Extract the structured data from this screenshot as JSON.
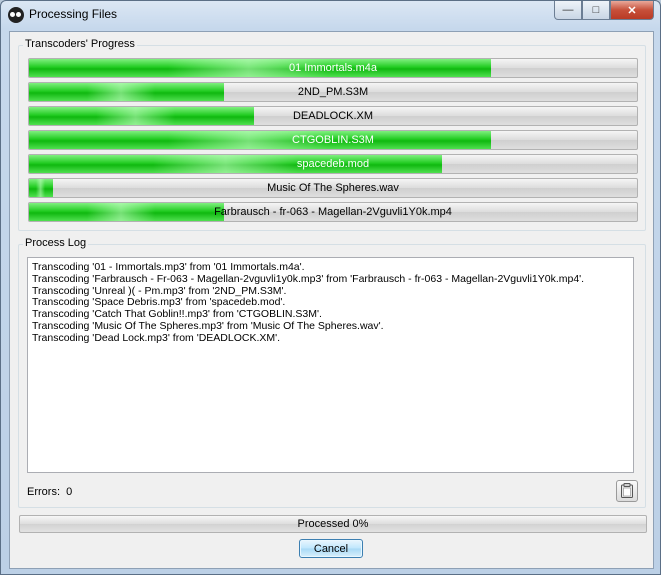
{
  "window": {
    "title": "Processing Files",
    "minimize_glyph": "—",
    "maximize_glyph": "□",
    "close_glyph": "✕"
  },
  "transcoders": {
    "label": "Transcoders' Progress",
    "bars": [
      {
        "file": "01 Immortals.m4a",
        "progress": 0.76,
        "text_color": "#ffffff"
      },
      {
        "file": "2ND_PM.S3M",
        "progress": 0.32,
        "text_color": "#000000"
      },
      {
        "file": "DEADLOCK.XM",
        "progress": 0.37,
        "text_color": "#000000"
      },
      {
        "file": "CTGOBLIN.S3M",
        "progress": 0.76,
        "text_color": "#ffffff"
      },
      {
        "file": "spacedeb.mod",
        "progress": 0.68,
        "text_color": "#ffffff"
      },
      {
        "file": "Music Of The Spheres.wav",
        "progress": 0.04,
        "text_color": "#000000"
      },
      {
        "file": "Farbrausch - fr-063 - Magellan-2Vguvli1Y0k.mp4",
        "progress": 0.32,
        "text_color": "#000000"
      }
    ]
  },
  "log": {
    "label": "Process Log",
    "lines": [
      "Transcoding '01 - Immortals.mp3' from '01 Immortals.m4a'.",
      "Transcoding 'Farbrausch - Fr-063 - Magellan-2vguvli1y0k.mp3' from 'Farbrausch - fr-063 - Magellan-2Vguvli1Y0k.mp4'.",
      "Transcoding 'Unreal )( - Pm.mp3' from '2ND_PM.S3M'.",
      "Transcoding 'Space Debris.mp3' from 'spacedeb.mod'.",
      "Transcoding 'Catch That Goblin!!.mp3' from 'CTGOBLIN.S3M'.",
      "Transcoding 'Music Of The Spheres.mp3' from 'Music Of The Spheres.wav'.",
      "Transcoding 'Dead Lock.mp3' from 'DEADLOCK.XM'."
    ]
  },
  "errors": {
    "label": "Errors:",
    "count": "0"
  },
  "overall": {
    "text": "Processed 0%",
    "progress": 0
  },
  "buttons": {
    "cancel": "Cancel",
    "copy_icon": "clipboard-icon"
  },
  "colors": {
    "progress_green": "#22cc22",
    "accent_blue": "#3c7fb1"
  }
}
